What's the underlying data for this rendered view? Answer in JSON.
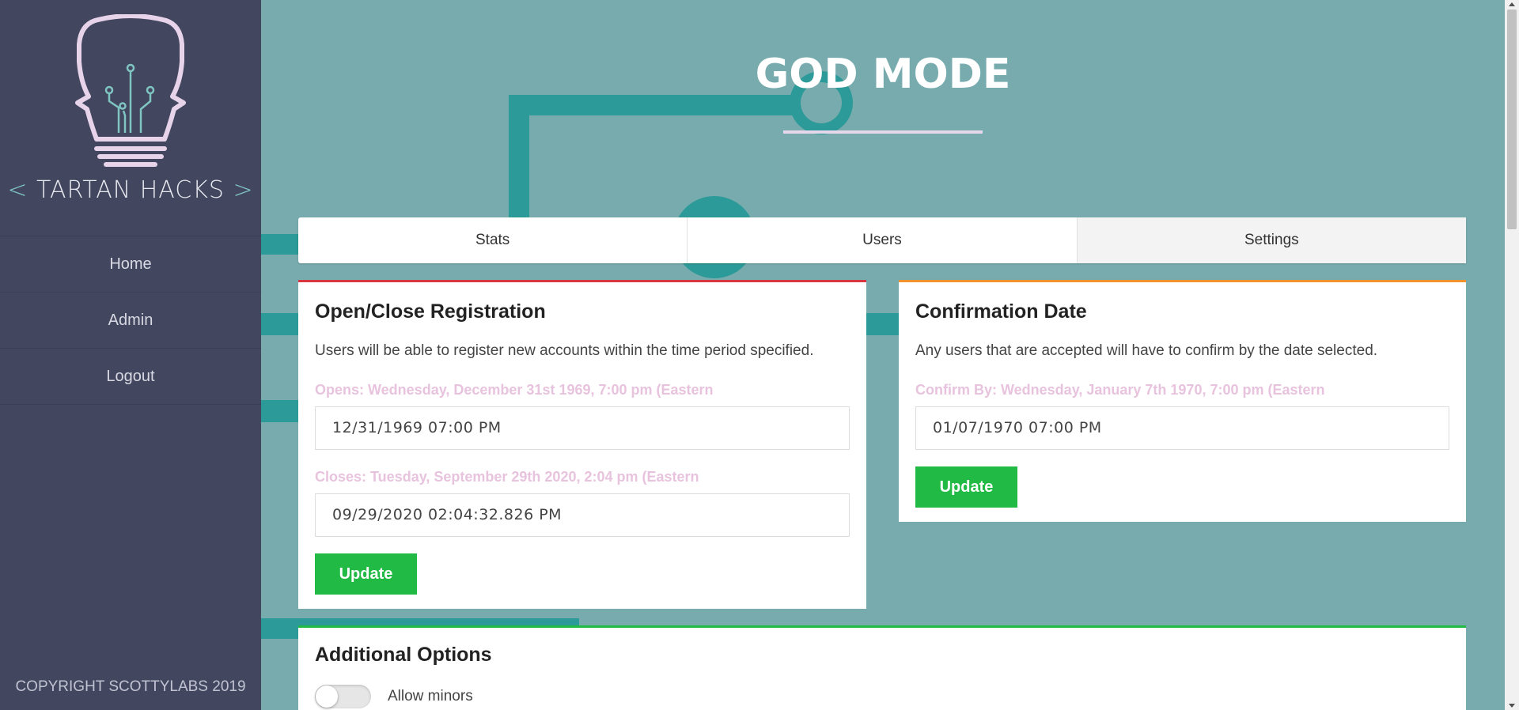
{
  "sidebar": {
    "logo_text": "TARTAN HACKS",
    "logo_bracket_left": "<",
    "logo_bracket_right": ">",
    "nav": [
      "Home",
      "Admin",
      "Logout"
    ],
    "copyright": "COPYRIGHT SCOTTYLABS 2019"
  },
  "page": {
    "title": "GOD MODE"
  },
  "tabs": [
    "Stats",
    "Users",
    "Settings"
  ],
  "registration": {
    "heading": "Open/Close Registration",
    "description": "Users will be able to register new accounts within the time period specified.",
    "opens_label": "Opens: Wednesday, December 31st 1969, 7:00 pm (Eastern",
    "opens_value": "12/31/1969 07:00 PM",
    "closes_label": "Closes: Tuesday, September 29th 2020, 2:04 pm (Eastern",
    "closes_value": "09/29/2020 02:04:32.826 PM",
    "button": "Update"
  },
  "confirmation": {
    "heading": "Confirmation Date",
    "description": "Any users that are accepted will have to confirm by the date selected.",
    "confirm_label": "Confirm By: Wednesday, January 7th 1970, 7:00 pm (Eastern",
    "confirm_value": "01/07/1970 07:00 PM",
    "button": "Update"
  },
  "options": {
    "heading": "Additional Options",
    "allow_minors_label": "Allow minors",
    "allow_minors_enabled": false
  },
  "colors": {
    "sidebar_bg": "#42475f",
    "main_bg": "#77abae",
    "circuit": "#2c9a98",
    "button_green": "#21ba45",
    "label_pink": "#e8c3de",
    "registration_accent": "#d9373f",
    "confirmation_accent": "#f2922e",
    "options_accent": "#21ba45"
  }
}
